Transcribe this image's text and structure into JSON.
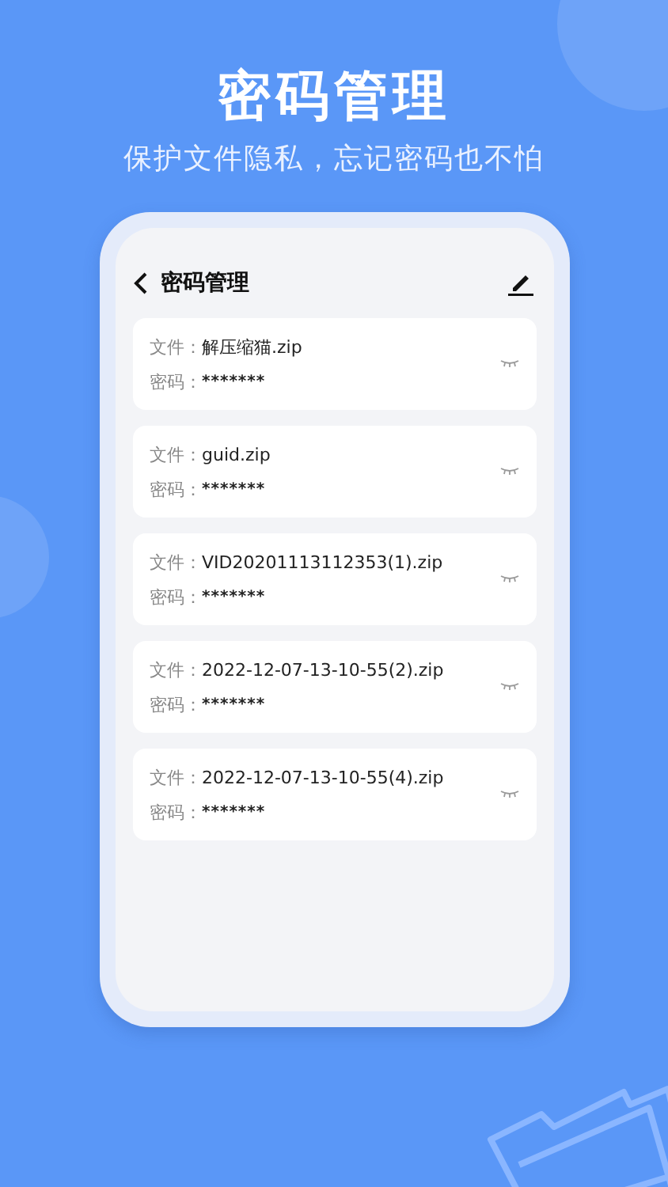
{
  "hero": {
    "title": "密码管理",
    "subtitle": "保护文件隐私，忘记密码也不怕"
  },
  "app": {
    "title": "密码管理"
  },
  "files": [
    {
      "file_label": "文件：",
      "name": "解压缩猫.zip",
      "password_label": "密码：",
      "password": "*******"
    },
    {
      "file_label": "文件：",
      "name": "guid.zip",
      "password_label": "密码：",
      "password": "*******"
    },
    {
      "file_label": "文件：",
      "name": "VID20201113112353(1).zip",
      "password_label": "密码：",
      "password": "*******"
    },
    {
      "file_label": "文件：",
      "name": "2022-12-07-13-10-55(2).zip",
      "password_label": "密码：",
      "password": "*******"
    },
    {
      "file_label": "文件：",
      "name": "2022-12-07-13-10-55(4).zip",
      "password_label": "密码：",
      "password": "*******"
    }
  ]
}
